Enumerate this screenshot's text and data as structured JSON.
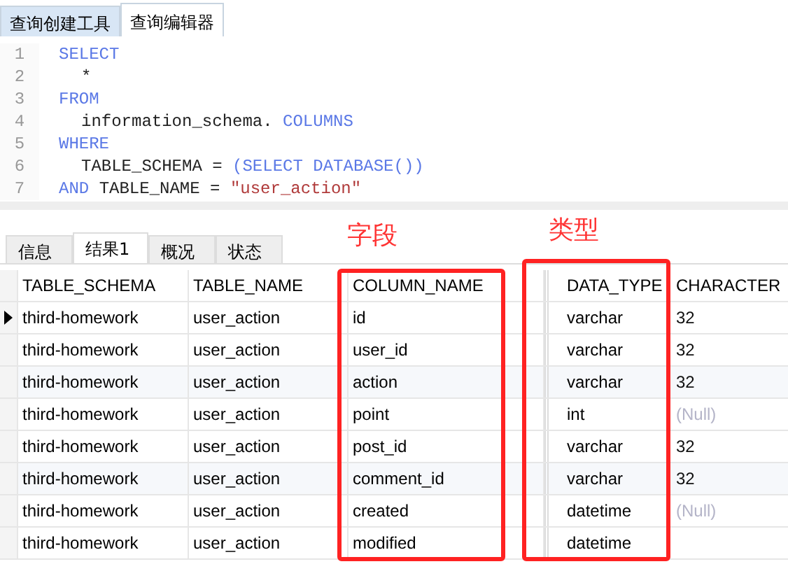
{
  "tabs": [
    {
      "label": "查询创建工具",
      "selected": false
    },
    {
      "label": "查询编辑器",
      "selected": true
    }
  ],
  "editor": {
    "lines": [
      {
        "number": "1",
        "indent": false,
        "tokens": [
          {
            "kind": "keyword",
            "text": "SELECT"
          }
        ]
      },
      {
        "number": "2",
        "indent": true,
        "tokens": [
          {
            "kind": "plain",
            "text": "*"
          }
        ]
      },
      {
        "number": "3",
        "indent": false,
        "tokens": [
          {
            "kind": "keyword",
            "text": "FROM"
          }
        ]
      },
      {
        "number": "4",
        "indent": true,
        "tokens": [
          {
            "kind": "plain",
            "text": "information_schema. "
          },
          {
            "kind": "keyword",
            "text": "COLUMNS"
          }
        ]
      },
      {
        "number": "5",
        "indent": false,
        "tokens": [
          {
            "kind": "keyword",
            "text": "WHERE"
          }
        ]
      },
      {
        "number": "6",
        "indent": true,
        "tokens": [
          {
            "kind": "plain",
            "text": "TABLE_SCHEMA = "
          },
          {
            "kind": "keyword",
            "text": "(SELECT DATABASE())"
          }
        ]
      },
      {
        "number": "7",
        "indent": false,
        "tokens": [
          {
            "kind": "keyword",
            "text": "AND "
          },
          {
            "kind": "plain",
            "text": "TABLE_NAME = "
          },
          {
            "kind": "string",
            "text": "\"user_action\""
          }
        ]
      }
    ]
  },
  "result_tabs": [
    {
      "label": "信息",
      "selected": false
    },
    {
      "label": "结果1",
      "selected": true
    },
    {
      "label": "概况",
      "selected": false
    },
    {
      "label": "状态",
      "selected": false
    }
  ],
  "annotations": [
    {
      "label": "字段"
    },
    {
      "label": "类型"
    }
  ],
  "table": {
    "columns": [
      "TABLE_SCHEMA",
      "TABLE_NAME",
      "COLUMN_NAME",
      "DATA_TYPE",
      "CHARACTER"
    ],
    "rows": [
      {
        "selected": true,
        "table_schema": "third-homework",
        "table_name": "user_action",
        "column_name": "id",
        "data_type": "varchar",
        "character": {
          "text": "32",
          "is_null": false
        }
      },
      {
        "selected": false,
        "table_schema": "third-homework",
        "table_name": "user_action",
        "column_name": "user_id",
        "data_type": "varchar",
        "character": {
          "text": "32",
          "is_null": false
        }
      },
      {
        "selected": false,
        "table_schema": "third-homework",
        "table_name": "user_action",
        "column_name": "action",
        "data_type": "varchar",
        "character": {
          "text": "32",
          "is_null": false
        }
      },
      {
        "selected": false,
        "table_schema": "third-homework",
        "table_name": "user_action",
        "column_name": "point",
        "data_type": "int",
        "character": {
          "text": "(Null)",
          "is_null": true
        }
      },
      {
        "selected": false,
        "table_schema": "third-homework",
        "table_name": "user_action",
        "column_name": "post_id",
        "data_type": "varchar",
        "character": {
          "text": "32",
          "is_null": false
        }
      },
      {
        "selected": false,
        "table_schema": "third-homework",
        "table_name": "user_action",
        "column_name": "comment_id",
        "data_type": "varchar",
        "character": {
          "text": "32",
          "is_null": false
        }
      },
      {
        "selected": false,
        "table_schema": "third-homework",
        "table_name": "user_action",
        "column_name": "created",
        "data_type": "datetime",
        "character": {
          "text": "(Null)",
          "is_null": true
        }
      },
      {
        "selected": false,
        "table_schema": "third-homework",
        "table_name": "user_action",
        "column_name": "modified",
        "data_type": "datetime"
      }
    ]
  }
}
